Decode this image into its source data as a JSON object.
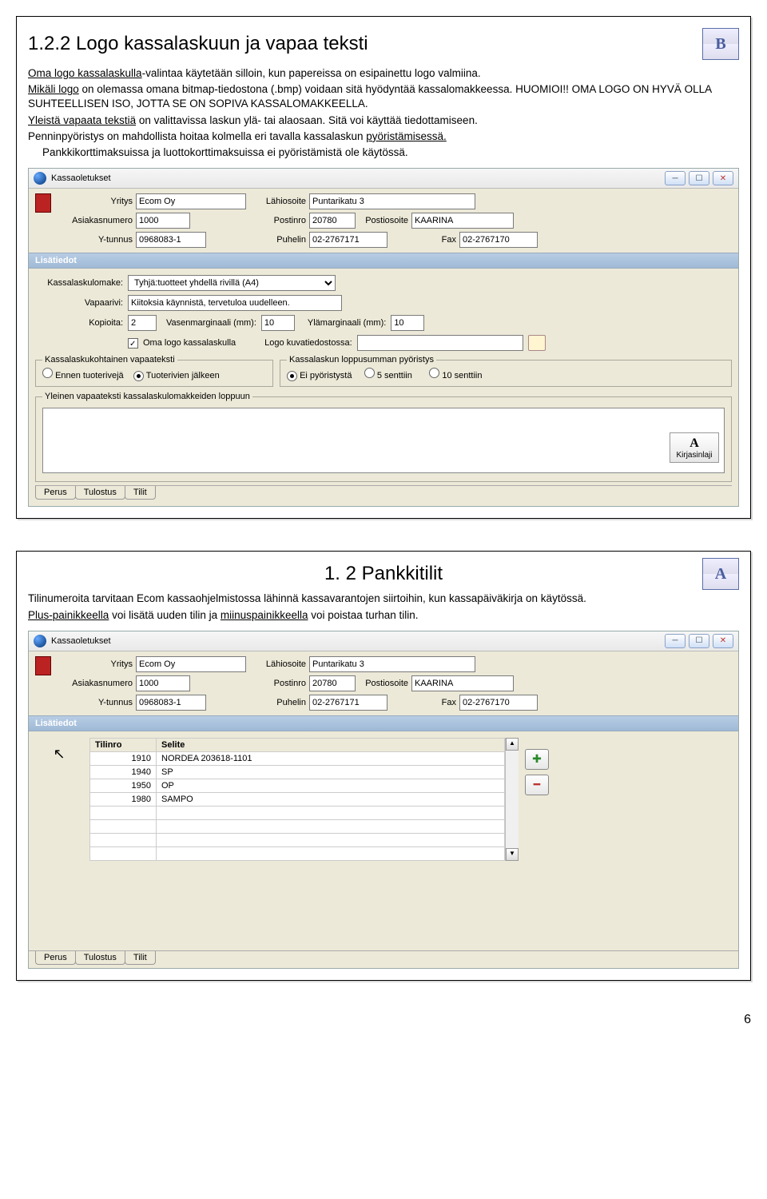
{
  "page_number": "6",
  "section1": {
    "heading": "1.2.2 Logo kassalaskuun ja vapaa teksti",
    "logo_letter": "B",
    "para1_html": "<u>Oma logo kassalaskulla</u>-valintaa käytetään silloin, kun papereissa on esipainettu logo valmiina.",
    "para2_html": "<u>Mikäli logo</u> on olemassa omana bitmap-tiedostona  (.bmp) voidaan sitä hyödyntää kassalomakkeessa. HUOMIOI!! OMA LOGO ON HYVÄ OLLA SUHTEELLISEN ISO, JOTTA SE ON SOPIVA KASSALOMAKKEELLA.",
    "para3_html": "<u>Yleistä vapaata tekstiä</u> on valittavissa laskun ylä- tai alaosaan. Sitä voi käyttää tiedottamiseen.",
    "para4_html": "Penninpyöristys on mahdollista hoitaa kolmella eri tavalla kassalaskun <u>pyöristämisessä.</u>",
    "para5_html": "Pankkikorttimaksuissa ja luottokorttimaksuissa ei pyöristämistä ole käytössä."
  },
  "app": {
    "title": "Kassaoletukset",
    "fields": {
      "yritys_label": "Yritys",
      "yritys": "Ecom Oy",
      "asiakasnumero_label": "Asiakasnumero",
      "asiakasnumero": "1000",
      "ytunnus_label": "Y-tunnus",
      "ytunnus": "0968083-1",
      "lahiosoite_label": "Lähiosoite",
      "lahiosoite": "Puntarikatu 3",
      "postinro_label": "Postinro",
      "postinro": "20780",
      "postiosoite_label": "Postiosoite",
      "postiosoite": "KAARINA",
      "puhelin_label": "Puhelin",
      "puhelin": "02-2767171",
      "fax_label": "Fax",
      "fax": "02-2767170"
    },
    "lisatiedot_label": "Lisätiedot",
    "lomake_label": "Kassalaskulomake:",
    "lomake_value": "Tyhjä:tuotteet yhdellä rivillä (A4)",
    "vapaarivi_label": "Vapaarivi:",
    "vapaarivi_value": "Kiitoksia käynnistä, tervetuloa uudelleen.",
    "kopioita_label": "Kopioita:",
    "kopioita_value": "2",
    "vasenmarg_label": "Vasenmarginaali (mm):",
    "vasenmarg_value": "10",
    "ylamarg_label": "Ylämarginaali (mm):",
    "ylamarg_value": "10",
    "ownlogo_label": "Oma logo kassalaskulla",
    "logofile_label": "Logo kuvatiedostossa:",
    "fs1_legend": "Kassalaskukohtainen vapaateksti",
    "fs1_opt1": "Ennen tuoterivejä",
    "fs1_opt2": "Tuoterivien jälkeen",
    "fs2_legend": "Kassalaskun loppusumman pyöristys",
    "fs2_opt1": "Ei pyöristystä",
    "fs2_opt2": "5 senttiin",
    "fs2_opt3": "10 senttiin",
    "freetext_legend": "Yleinen vapaateksti kassalaskulomakkeiden loppuun",
    "font_btn": "Kirjasinlaji",
    "tabs": [
      "Perus",
      "Tulostus",
      "Tilit"
    ]
  },
  "section2": {
    "heading": "1. 2 Pankkitilit",
    "logo_letter": "A",
    "para1": "Tilinumeroita tarvitaan Ecom kassaohjelmistossa lähinnä kassavarantojen siirtoihin, kun kassapäiväkirja on käytössä.",
    "para2_html": "<u>Plus-painikkeella</u> voi lisätä uuden tilin ja <u>miinuspainikkeella</u> voi poistaa turhan tilin."
  },
  "accounts": {
    "col1": "Tilinro",
    "col2": "Selite",
    "rows": [
      {
        "tilinro": "1910",
        "selite": "NORDEA 203618-1101"
      },
      {
        "tilinro": "1940",
        "selite": "SP"
      },
      {
        "tilinro": "1950",
        "selite": "OP"
      },
      {
        "tilinro": "1980",
        "selite": "SAMPO"
      }
    ]
  }
}
